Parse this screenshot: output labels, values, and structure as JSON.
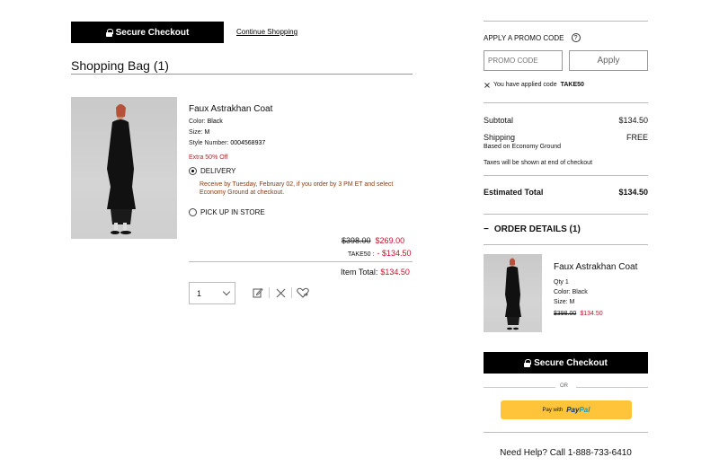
{
  "header": {
    "secure_checkout": "Secure Checkout",
    "continue_shopping": "Continue Shopping"
  },
  "bag": {
    "title": "Shopping Bag (1)"
  },
  "item": {
    "name": "Faux Astrakhan Coat",
    "color_label": "Color:",
    "color": "Black",
    "size_label": "Size:",
    "size": "M",
    "style_label": "Style Number:",
    "style": "0004568937",
    "promo": "Extra 50% Off",
    "delivery_label": "DELIVERY",
    "delivery_msg": "Receive by Tuesday, February 02, if you order by 3 PM ET and select Economy Ground at checkout.",
    "pickup_label": "PICK UP IN STORE",
    "original_price": "$398.00",
    "sale_price": "$269.00",
    "code_label": "TAKE50 :",
    "code_discount": "- $134.50",
    "item_total_label": "Item Total:",
    "item_total": "$134.50",
    "qty": "1"
  },
  "promo": {
    "title": "APPLY A PROMO CODE",
    "help": "?",
    "placeholder": "PROMO CODE",
    "apply": "Apply",
    "applied_prefix": "You have applied code",
    "applied_code": "TAKE50"
  },
  "summary": {
    "subtotal_label": "Subtotal",
    "subtotal": "$134.50",
    "shipping_label": "Shipping",
    "shipping": "FREE",
    "shipping_note": "Based on Economy Ground",
    "taxes_note": "Taxes will be shown at end of checkout",
    "estimated_label": "Estimated Total",
    "estimated": "$134.50"
  },
  "order": {
    "toggle": "−",
    "title": "ORDER DETAILS (1)",
    "name": "Faux Astrakhan Coat",
    "qty": "Qty 1",
    "color": "Color: Black",
    "size": "Size: M",
    "original_price": "$398.00",
    "sale_price": "$134.50"
  },
  "footer": {
    "secure_checkout": "Secure Checkout",
    "or": "OR",
    "paypal_prefix": "Pay with",
    "paypal_a": "Pay",
    "paypal_b": "Pal",
    "help": "Need Help? Call 1-888-733-6410"
  },
  "colors": {
    "accent_red": "#c8102e",
    "paypal_yellow": "#ffc439",
    "black": "#000000"
  }
}
